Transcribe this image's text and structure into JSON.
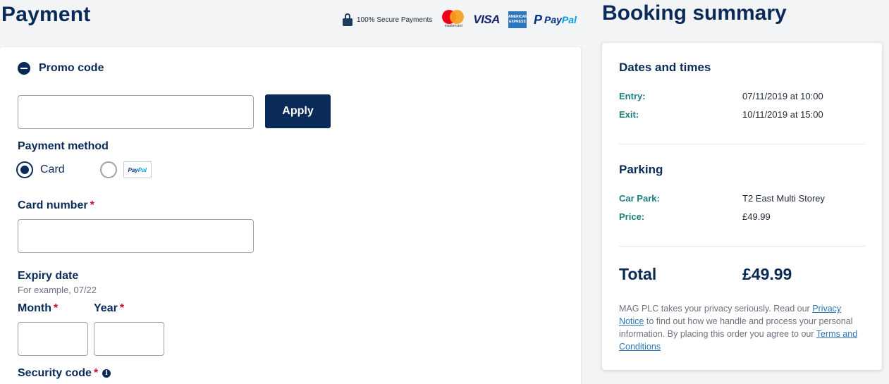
{
  "payment": {
    "title": "Payment",
    "secure_text": "100% Secure Payments",
    "logos": {
      "mastercard_label": "mastercard",
      "visa": "VISA",
      "amex": "AMERICAN EXPRESS",
      "paypal_pay": "Pay",
      "paypal_pal": "Pal"
    },
    "promo": {
      "label": "Promo code",
      "input_value": "",
      "input_placeholder": "",
      "apply_label": "Apply"
    },
    "method": {
      "label": "Payment method",
      "options": [
        {
          "label": "Card",
          "selected": true
        },
        {
          "label": "PayPal",
          "selected": false,
          "chip_pay": "Pay",
          "chip_pal": "Pal"
        }
      ]
    },
    "card_number": {
      "label": "Card number",
      "required_mark": "*",
      "value": ""
    },
    "expiry": {
      "label": "Expiry date",
      "hint": "For example, 07/22",
      "month_label": "Month",
      "year_label": "Year",
      "required_mark": "*",
      "month_value": "",
      "year_value": ""
    },
    "security": {
      "label": "Security code",
      "required_mark": "*",
      "info_icon": "i"
    }
  },
  "summary": {
    "title": "Booking summary",
    "dates_heading": "Dates and times",
    "entry_label": "Entry:",
    "entry_value": "07/11/2019 at 10:00",
    "exit_label": "Exit:",
    "exit_value": "10/11/2019 at 15:00",
    "parking_heading": "Parking",
    "carpark_label": "Car Park:",
    "carpark_value": "T2 East Multi Storey",
    "price_label": "Price:",
    "price_value": "£49.99",
    "total_label": "Total",
    "total_value": "£49.99",
    "privacy_1": "MAG PLC takes your privacy seriously. Read our ",
    "privacy_link": "Privacy Notice",
    "privacy_2": " to find out how we handle and process your personal information. By placing this order you agree to our ",
    "terms_link": "Terms and Conditions"
  },
  "colors": {
    "navy": "#0a2a57",
    "teal_label": "#1b7f7d",
    "required_red": "#c8102e",
    "link_blue": "#2f78b7",
    "background": "#f3f4f6"
  },
  "icons": [
    "lock-icon",
    "mastercard-logo",
    "visa-logo",
    "amex-logo",
    "paypal-logo",
    "minus-circle-icon",
    "radio-selected",
    "radio-unselected",
    "info-icon"
  ]
}
